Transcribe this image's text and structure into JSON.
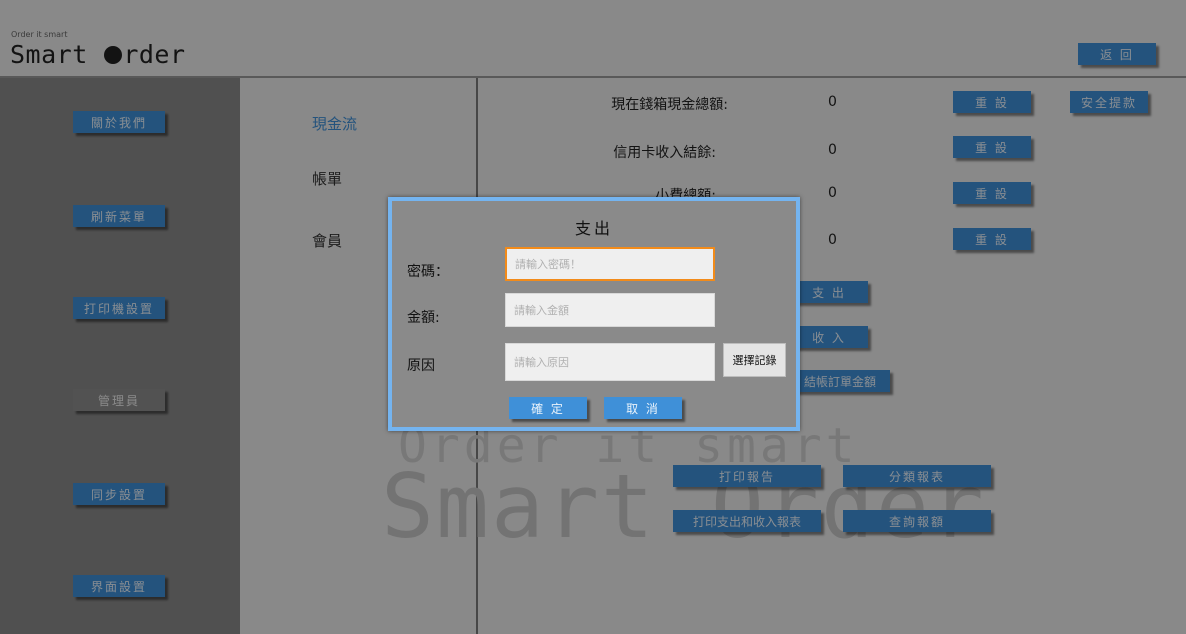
{
  "header": {
    "logo_tagline": "Order it smart",
    "logo_prefix": "Smart ",
    "logo_suffix": "rder",
    "back_label": "返 回"
  },
  "sidebar": {
    "items": [
      {
        "label": "關於我們"
      },
      {
        "label": "刷新菜單"
      },
      {
        "label": "打印機設置"
      },
      {
        "label": "管理員"
      },
      {
        "label": "同步設置"
      },
      {
        "label": "界面設置"
      }
    ]
  },
  "tabs": [
    {
      "label": "現金流"
    },
    {
      "label": "帳單"
    },
    {
      "label": "會員"
    }
  ],
  "cash": {
    "rows": [
      {
        "label": "現在錢箱現金總額:",
        "value": "0",
        "button": "重 設"
      },
      {
        "label": "信用卡收入結餘:",
        "value": "0",
        "button": "重 設"
      },
      {
        "label": "小費總額:",
        "value": "0",
        "button": "重 設"
      },
      {
        "label": "",
        "value": "0",
        "button": "重 設"
      }
    ],
    "safe_withdraw_label": "安全提款",
    "expense_label": "支 出",
    "income_label": "收 入",
    "order_amount_label": "結帳訂單金額",
    "print_report_label": "打印報告",
    "category_report_label": "分類報表",
    "print_expense_income_label": "打印支出和收入報表",
    "view_report_label": "查詢報額"
  },
  "watermark": {
    "line1": "Order it smart",
    "line2": "Smart Order"
  },
  "dialog": {
    "title": "支出",
    "password_label": "密碼：",
    "password_placeholder": "請輸入密碼！",
    "amount_label": "金額:",
    "amount_placeholder": "請輸入金額",
    "reason_label": "原因",
    "reason_placeholder": "請輸入原因",
    "choose_record_label": "選擇記錄",
    "confirm_label": "確 定",
    "cancel_label": "取 消"
  },
  "colors": {
    "accent": "#3f90d8",
    "dialog_border": "#74b4f0",
    "focus_border": "#f28b1a"
  }
}
